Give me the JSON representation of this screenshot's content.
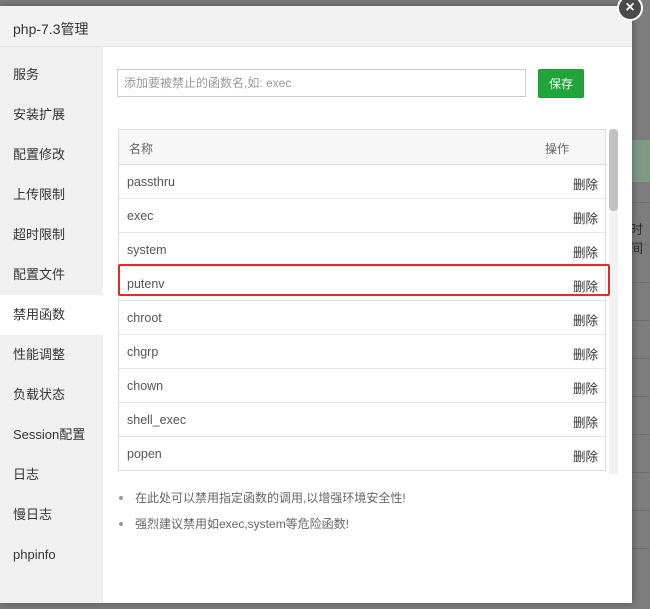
{
  "modal": {
    "title": "php-7.3管理",
    "close_icon": "close-icon"
  },
  "sidebar": {
    "items": [
      {
        "label": "服务"
      },
      {
        "label": "安装扩展"
      },
      {
        "label": "配置修改"
      },
      {
        "label": "上传限制"
      },
      {
        "label": "超时限制"
      },
      {
        "label": "配置文件"
      },
      {
        "label": "禁用函数",
        "active": true
      },
      {
        "label": "性能调整"
      },
      {
        "label": "负载状态"
      },
      {
        "label": "Session配置"
      },
      {
        "label": "日志"
      },
      {
        "label": "慢日志"
      },
      {
        "label": "phpinfo"
      }
    ]
  },
  "content": {
    "input": {
      "placeholder": "添加要被禁止的函数名,如: exec",
      "value": ""
    },
    "save_label": "保存",
    "table": {
      "headers": {
        "name": "名称",
        "action": "操作"
      },
      "rows": [
        {
          "name": "passthru",
          "action": "删除"
        },
        {
          "name": "exec",
          "action": "删除"
        },
        {
          "name": "system",
          "action": "删除"
        },
        {
          "name": "putenv",
          "action": "删除"
        },
        {
          "name": "chroot",
          "action": "删除"
        },
        {
          "name": "chgrp",
          "action": "删除"
        },
        {
          "name": "chown",
          "action": "删除"
        },
        {
          "name": "shell_exec",
          "action": "删除"
        },
        {
          "name": "popen",
          "action": "删除"
        }
      ]
    },
    "tips": [
      "在此处可以禁用指定函数的调用,以增强环境安全性!",
      "强烈建议禁用如exec,system等危险函数!"
    ]
  },
  "background": {
    "partial_text": "时间"
  },
  "colors": {
    "accent_green": "#20a53a",
    "highlight_red": "#e22b2b"
  }
}
